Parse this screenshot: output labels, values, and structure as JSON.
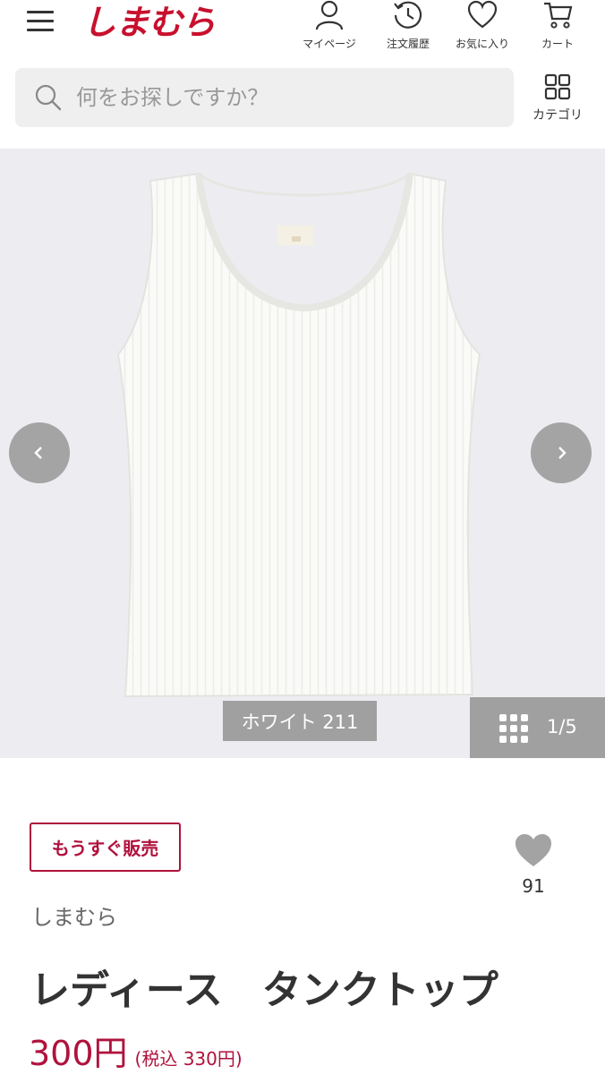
{
  "header": {
    "logo": "しまむら",
    "nav": [
      {
        "label": "マイページ",
        "icon": "user-icon"
      },
      {
        "label": "注文履歴",
        "icon": "history-icon"
      },
      {
        "label": "お気に入り",
        "icon": "heart-icon"
      },
      {
        "label": "カート",
        "icon": "cart-icon"
      }
    ]
  },
  "search": {
    "placeholder": "何をお探しですか？",
    "category_label": "カテゴリ"
  },
  "gallery": {
    "color_label": "ホワイト 211",
    "counter": "1/5"
  },
  "product": {
    "status": "もうすぐ販売",
    "favorite_count": "91",
    "brand": "しまむら",
    "title": "レディース　タンクトップ",
    "price": "300円",
    "price_tax": "(税込 330円)"
  },
  "colors": {
    "brand_red": "#c8102e",
    "price_red": "#b0123d"
  }
}
